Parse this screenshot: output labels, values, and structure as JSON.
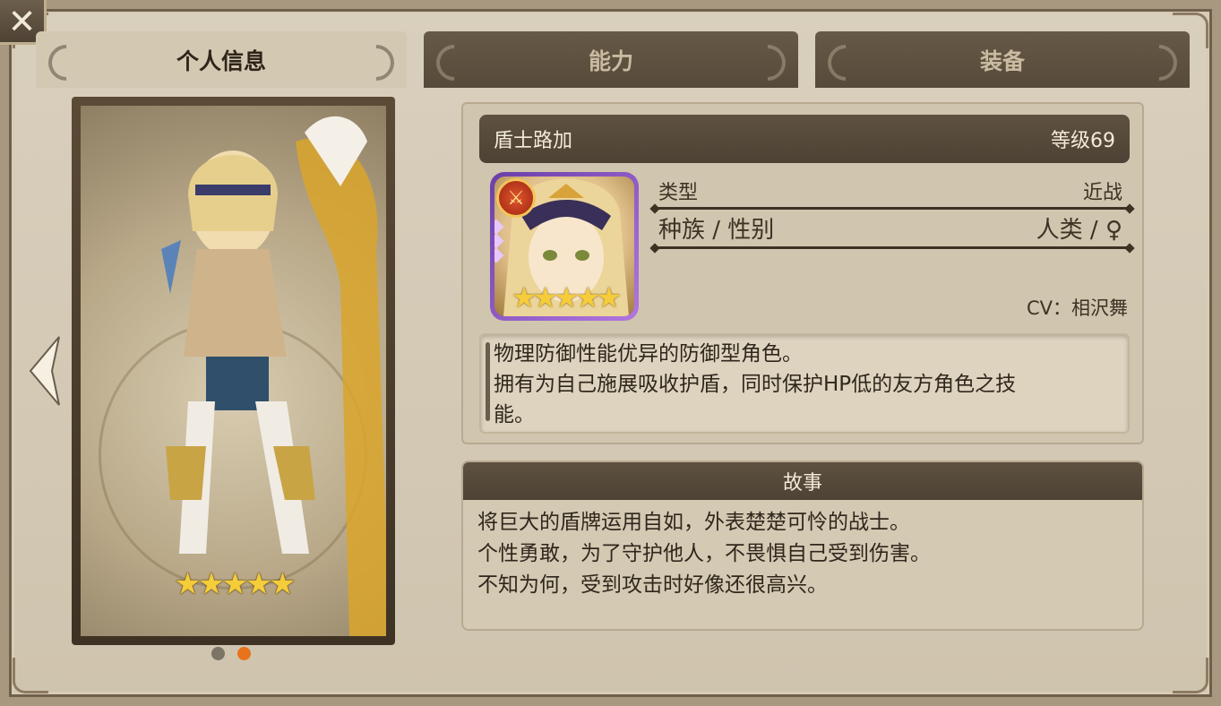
{
  "close": {
    "icon": "close-icon",
    "label": "✕"
  },
  "tabs": [
    {
      "label": "个人信息",
      "active": true
    },
    {
      "label": "能力",
      "active": false
    },
    {
      "label": "装备",
      "active": false
    }
  ],
  "portrait": {
    "stars": "★★★★★",
    "rarity": 5
  },
  "pagination": {
    "pages": 2,
    "current": 2,
    "active_color": "#e8731c",
    "inactive_color": "#7c7464"
  },
  "character": {
    "name": "盾士路加",
    "level": "等级69",
    "role_icon": "sword-icon",
    "stars": "★★★★★",
    "attributes": [
      {
        "label": "类型",
        "value": "近战"
      },
      {
        "label": "种族 / 性别",
        "value": "人类 / ♀"
      }
    ],
    "cv": "CV：相沢舞",
    "description": [
      "物理防御性能优异的防御型角色。",
      "拥有为自己施展吸收护盾，同时保护HP低的友方角色之技",
      "能。"
    ]
  },
  "story": {
    "title": "故事",
    "lines": [
      "将巨大的盾牌运用自如，外表楚楚可怜的战士。",
      "个性勇敢，为了守护他人，不畏惧自己受到伤害。",
      "不知为何，受到攻击时好像还很高兴。"
    ]
  }
}
